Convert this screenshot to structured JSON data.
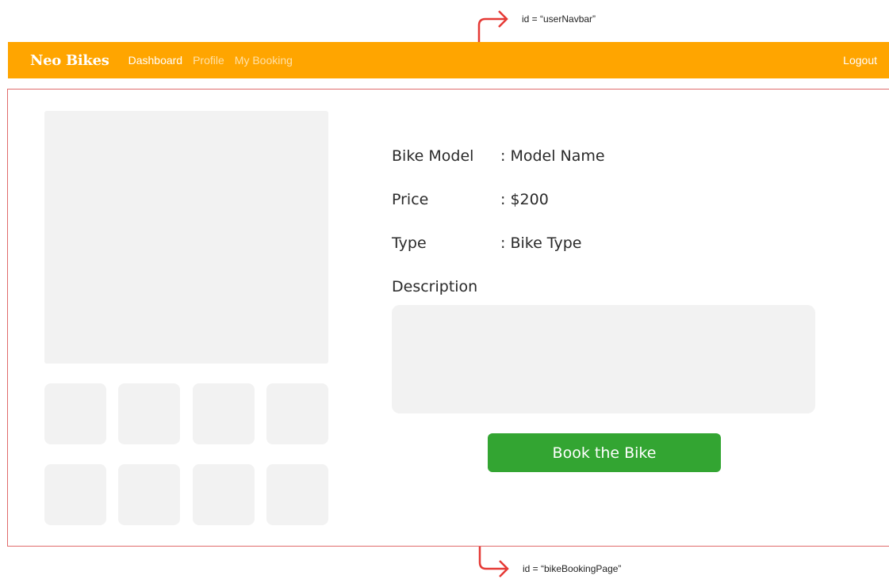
{
  "annotations": {
    "navbar_id": "id = “userNavbar”",
    "page_id": "id = “bikeBookingPage”",
    "arrow_color": "#E53935"
  },
  "navbar": {
    "brand": "Neo Bikes",
    "links": [
      "Dashboard",
      "Profile",
      "My Booking"
    ],
    "logout": "Logout",
    "background": "#FFA500"
  },
  "details": {
    "model_label": "Bike Model",
    "model_value": ": Model Name",
    "price_label": "Price",
    "price_value": ": $200",
    "type_label": "Type",
    "type_value": ": Bike Type",
    "description_label": "Description",
    "description_value": ""
  },
  "actions": {
    "book_label": "Book the Bike",
    "book_color": "#33A532"
  }
}
